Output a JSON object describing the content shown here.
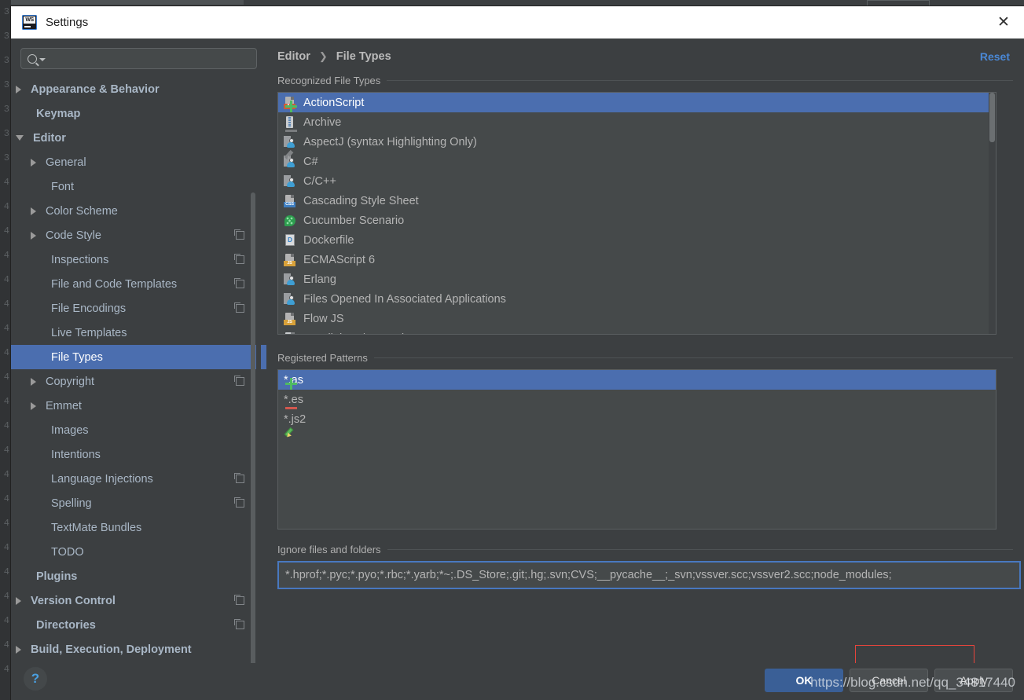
{
  "window": {
    "title": "Settings",
    "app_icon": "webstorm-icon",
    "close_icon": "close-icon"
  },
  "search": {
    "placeholder": "",
    "value": "",
    "icon": "search-icon"
  },
  "sidebar": {
    "items": [
      {
        "label": "Appearance & Behavior",
        "arrow": "closed",
        "bold": true,
        "indent": 14,
        "config": false,
        "selected": false
      },
      {
        "label": "Keymap",
        "arrow": "none",
        "bold": true,
        "indent": 33,
        "config": false,
        "selected": false
      },
      {
        "label": "Editor",
        "arrow": "open",
        "bold": true,
        "indent": 14,
        "config": false,
        "selected": false
      },
      {
        "label": "General",
        "arrow": "closed",
        "bold": false,
        "indent": 33,
        "config": false,
        "selected": false
      },
      {
        "label": "Font",
        "arrow": "none",
        "bold": false,
        "indent": 52,
        "config": false,
        "selected": false
      },
      {
        "label": "Color Scheme",
        "arrow": "closed",
        "bold": false,
        "indent": 33,
        "config": false,
        "selected": false
      },
      {
        "label": "Code Style",
        "arrow": "closed",
        "bold": false,
        "indent": 33,
        "config": true,
        "selected": false
      },
      {
        "label": "Inspections",
        "arrow": "none",
        "bold": false,
        "indent": 52,
        "config": true,
        "selected": false
      },
      {
        "label": "File and Code Templates",
        "arrow": "none",
        "bold": false,
        "indent": 52,
        "config": true,
        "selected": false
      },
      {
        "label": "File Encodings",
        "arrow": "none",
        "bold": false,
        "indent": 52,
        "config": true,
        "selected": false
      },
      {
        "label": "Live Templates",
        "arrow": "none",
        "bold": false,
        "indent": 52,
        "config": false,
        "selected": false
      },
      {
        "label": "File Types",
        "arrow": "none",
        "bold": false,
        "indent": 52,
        "config": false,
        "selected": true
      },
      {
        "label": "Copyright",
        "arrow": "closed",
        "bold": false,
        "indent": 33,
        "config": true,
        "selected": false
      },
      {
        "label": "Emmet",
        "arrow": "closed",
        "bold": false,
        "indent": 33,
        "config": false,
        "selected": false
      },
      {
        "label": "Images",
        "arrow": "none",
        "bold": false,
        "indent": 52,
        "config": false,
        "selected": false
      },
      {
        "label": "Intentions",
        "arrow": "none",
        "bold": false,
        "indent": 52,
        "config": false,
        "selected": false
      },
      {
        "label": "Language Injections",
        "arrow": "none",
        "bold": false,
        "indent": 52,
        "config": true,
        "selected": false
      },
      {
        "label": "Spelling",
        "arrow": "none",
        "bold": false,
        "indent": 52,
        "config": true,
        "selected": false
      },
      {
        "label": "TextMate Bundles",
        "arrow": "none",
        "bold": false,
        "indent": 52,
        "config": false,
        "selected": false
      },
      {
        "label": "TODO",
        "arrow": "none",
        "bold": false,
        "indent": 52,
        "config": false,
        "selected": false
      },
      {
        "label": "Plugins",
        "arrow": "none",
        "bold": true,
        "indent": 33,
        "config": false,
        "selected": false
      },
      {
        "label": "Version Control",
        "arrow": "closed",
        "bold": true,
        "indent": 14,
        "config": true,
        "selected": false
      },
      {
        "label": "Directories",
        "arrow": "none",
        "bold": true,
        "indent": 33,
        "config": true,
        "selected": false
      },
      {
        "label": "Build, Execution, Deployment",
        "arrow": "closed",
        "bold": true,
        "indent": 14,
        "config": false,
        "selected": false
      }
    ]
  },
  "breadcrumb": {
    "parent": "Editor",
    "separator": "❯",
    "current": "File Types"
  },
  "reset_link": "Reset",
  "recognized": {
    "title": "Recognized File Types",
    "rows": [
      {
        "label": "ActionScript",
        "icon": "actionscript-file-icon",
        "kind": "badge",
        "badge": "AS",
        "badge_color": "#cf5b3a",
        "selected": true
      },
      {
        "label": "Archive",
        "icon": "archive-file-icon",
        "kind": "zip",
        "badge": "",
        "badge_color": "",
        "selected": false
      },
      {
        "label": "AspectJ (syntax Highlighting Only)",
        "icon": "aspectj-file-icon",
        "kind": "person",
        "badge": "",
        "badge_color": "",
        "selected": false
      },
      {
        "label": "C#",
        "icon": "csharp-file-icon",
        "kind": "person",
        "badge": "",
        "badge_color": "",
        "selected": false
      },
      {
        "label": "C/C++",
        "icon": "cpp-file-icon",
        "kind": "person",
        "badge": "",
        "badge_color": "",
        "selected": false
      },
      {
        "label": "Cascading Style Sheet",
        "icon": "css-file-icon",
        "kind": "badge",
        "badge": "CSS",
        "badge_color": "#3f7fc1",
        "selected": false
      },
      {
        "label": "Cucumber Scenario",
        "icon": "cucumber-file-icon",
        "kind": "cuke",
        "badge": "",
        "badge_color": "",
        "selected": false
      },
      {
        "label": "Dockerfile",
        "icon": "dockerfile-icon",
        "kind": "docker",
        "badge": "D",
        "badge_color": "",
        "selected": false
      },
      {
        "label": "ECMAScript 6",
        "icon": "ecmascript6-file-icon",
        "kind": "badge",
        "badge": "JS",
        "badge_color": "#d8a13a",
        "selected": false
      },
      {
        "label": "Erlang",
        "icon": "erlang-file-icon",
        "kind": "person",
        "badge": "",
        "badge_color": "",
        "selected": false
      },
      {
        "label": "Files Opened In Associated Applications",
        "icon": "associated-apps-icon",
        "kind": "person",
        "badge": "",
        "badge_color": "",
        "selected": false
      },
      {
        "label": "Flow JS",
        "icon": "flowjs-file-icon",
        "kind": "badge",
        "badge": "JS",
        "badge_color": "#d8a13a",
        "selected": false
      },
      {
        "label": "Handlebars/Mustache",
        "icon": "handlebars-file-icon",
        "kind": "plainpg",
        "badge": "",
        "badge_color": "",
        "selected": false
      }
    ],
    "toolbar": [
      {
        "name": "add-file-type-button",
        "icon": "plus-icon",
        "enabled": true
      },
      {
        "name": "remove-file-type-button",
        "icon": "minus-icon",
        "enabled": false
      },
      {
        "name": "edit-file-type-button",
        "icon": "pencil-icon",
        "enabled": false
      }
    ]
  },
  "patterns": {
    "title": "Registered Patterns",
    "rows": [
      {
        "label": "*.as",
        "selected": true
      },
      {
        "label": "*.es",
        "selected": false
      },
      {
        "label": "*.js2",
        "selected": false
      }
    ],
    "toolbar": [
      {
        "name": "add-pattern-button",
        "icon": "plus-icon",
        "enabled": true
      },
      {
        "name": "remove-pattern-button",
        "icon": "minus-icon",
        "enabled": true
      },
      {
        "name": "edit-pattern-button",
        "icon": "pencil-icon",
        "enabled": true
      }
    ]
  },
  "ignore": {
    "title": "Ignore files and folders",
    "value": "*.hprof;*.pyc;*.pyo;*.rbc;*.yarb;*~;.DS_Store;.git;.hg;.svn;CVS;__pycache__;_svn;vssver.scc;vssver2.scc;node_modules;",
    "highlight_text": ";node_modules;"
  },
  "footer": {
    "help_label": "?",
    "buttons": [
      {
        "label": "OK",
        "primary": true
      },
      {
        "label": "Cancel",
        "primary": false
      },
      {
        "label": "Apply",
        "primary": false
      }
    ]
  },
  "watermark": "https://blog.csdn.net/qq_34817440",
  "colors": {
    "accent_selection": "#4b6eaf",
    "link": "#4a88d6",
    "focus_border": "#4878c0",
    "annotation_red": "#e8443c",
    "add_green": "#4fbb63",
    "remove_red": "#d2584f"
  },
  "gutter_lines": [
    "3",
    "3",
    "3",
    "3",
    "3",
    "3",
    "3",
    "4",
    "4",
    "4",
    "4",
    "4",
    "4",
    "4",
    "4",
    "4",
    "4",
    "4",
    "4",
    "4",
    "4",
    "4",
    "4",
    "4",
    "4",
    "4",
    "4",
    "4"
  ]
}
